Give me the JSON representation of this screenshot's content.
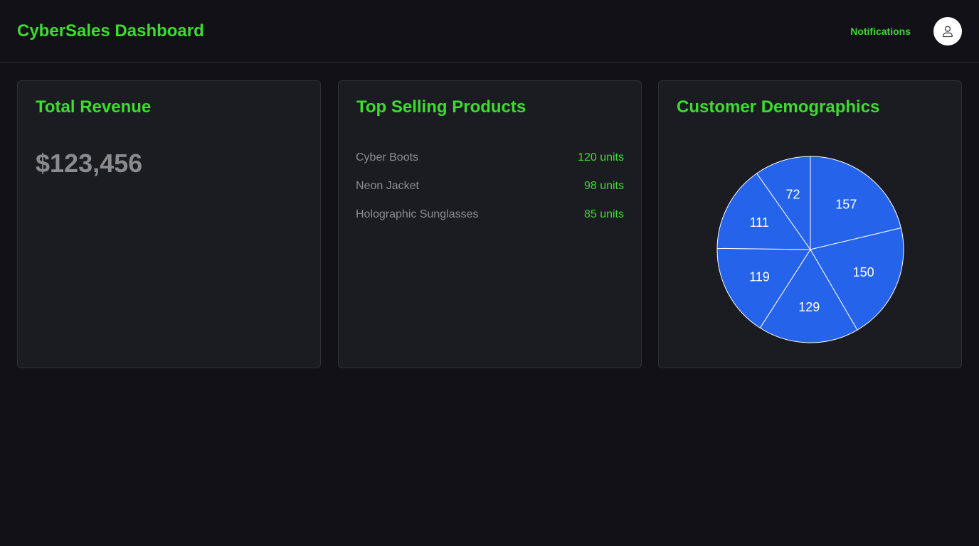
{
  "header": {
    "title": "CyberSales Dashboard",
    "notifications_label": "Notifications",
    "avatar_icon": "user-icon"
  },
  "revenue": {
    "title": "Total Revenue",
    "value": "$123,456"
  },
  "top_products": {
    "title": "Top Selling Products",
    "items": [
      {
        "name": "Cyber Boots",
        "units": "120 units"
      },
      {
        "name": "Neon Jacket",
        "units": "98 units"
      },
      {
        "name": "Holographic Sunglasses",
        "units": "85 units"
      }
    ]
  },
  "demographics": {
    "title": "Customer Demographics"
  },
  "colors": {
    "accent": "#3ddc2f",
    "background": "#111117",
    "card": "#1b1c22",
    "pie_fill": "#2563eb"
  },
  "chart_data": {
    "type": "pie",
    "title": "Customer Demographics",
    "values": [
      157,
      150,
      129,
      119,
      111,
      72
    ],
    "labels": [
      "157",
      "150",
      "129",
      "119",
      "111",
      "72"
    ],
    "start": "top",
    "direction": "clockwise",
    "color": "#2563eb"
  }
}
